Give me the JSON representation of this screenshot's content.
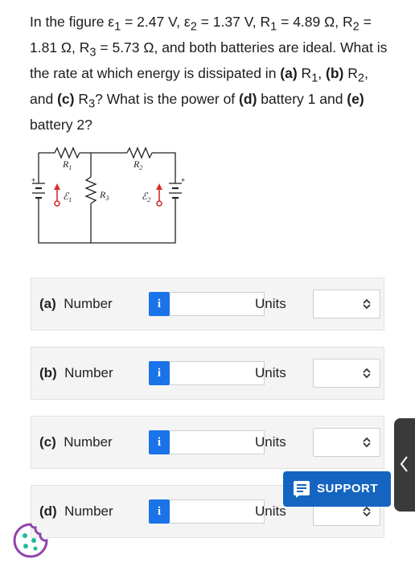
{
  "question": {
    "line1": "In the figure ε",
    "text_full": "In the figure ε1 = 2.47 V, ε2 = 1.37 V, R1 = 4.89 Ω, R2 = 1.81 Ω, R3 = 5.73 Ω, and both batteries are ideal. What is the rate at which energy is dissipated in (a) R1, (b) R2, and (c) R3? What is the power of (d) battery 1 and (e) battery 2?",
    "e1_value": "2.47 V",
    "e2_value": "1.37 V",
    "r1_value": "4.89 Ω",
    "r2_value": "1.81 Ω",
    "r3_value": "5.73 Ω",
    "t_intro": "In the figure ",
    "t_batt": ", and both batteries are ideal. What is the rate at which energy is dissipated in ",
    "t_r1": ", ",
    "t_r2": ", and ",
    "t_r3": "? What is the power of ",
    "t_b1": " battery 1 and ",
    "t_b2": " battery 2?"
  },
  "circuit": {
    "labels": {
      "r1": "R",
      "r1_sub": "1",
      "r2": "R",
      "r2_sub": "2",
      "r3": "R",
      "r3_sub": "3",
      "e1": "ℰ",
      "e1_sub": "1",
      "e2": "ℰ",
      "e2_sub": "2",
      "plus": "+",
      "minus": "−"
    }
  },
  "answers": [
    {
      "label": "(a)",
      "field": "Number",
      "info": "i",
      "units_label": "Units",
      "value": ""
    },
    {
      "label": "(b)",
      "field": "Number",
      "info": "i",
      "units_label": "Units",
      "value": ""
    },
    {
      "label": "(c)",
      "field": "Number",
      "info": "i",
      "units_label": "Units",
      "value": ""
    },
    {
      "label": "(d)",
      "field": "Number",
      "info": "i",
      "units_label": "Units",
      "value": ""
    }
  ],
  "support": {
    "label": "SUPPORT",
    "icon": "chat-lines-icon",
    "color": "#1565c0"
  },
  "colors": {
    "info_button": "#1a73e8",
    "side_tab": "#3a3a3a"
  }
}
